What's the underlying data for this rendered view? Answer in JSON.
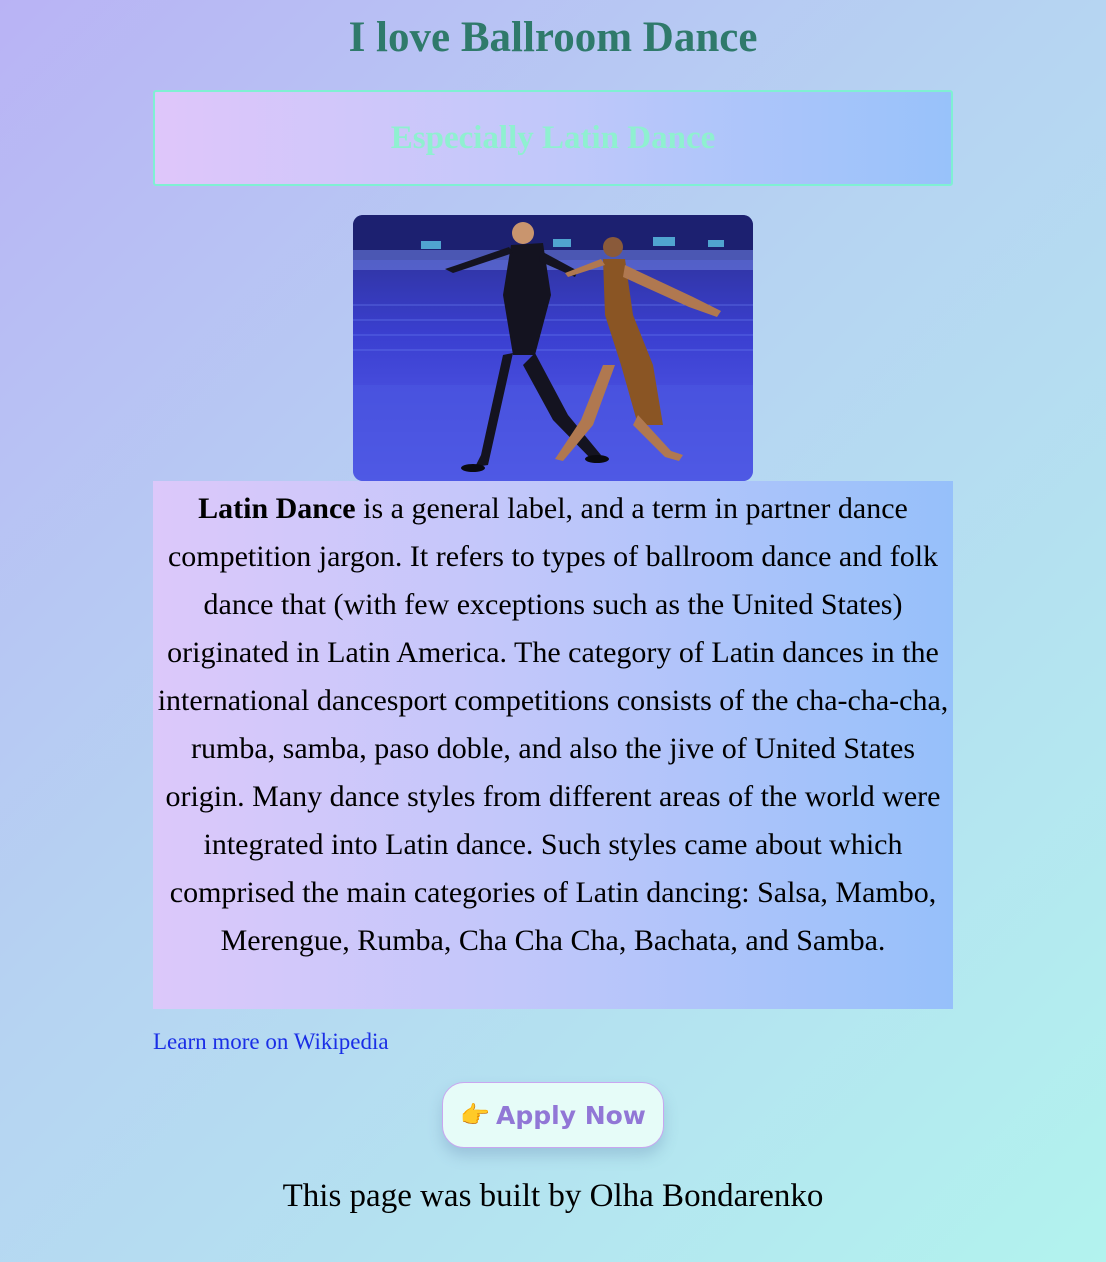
{
  "header": {
    "title": "I love Ballroom Dance"
  },
  "subtitle": "Especially Latin Dance",
  "article": {
    "bold_term": "Latin Dance",
    "body": " is a general label, and a term in partner dance competition jargon. It refers to types of ballroom dance and folk dance that (with few exceptions such as the United States) originated in Latin America. The category of Latin dances in the international dancesport competitions consists of the cha-cha-cha, rumba, samba, paso doble, and also the jive of United States origin. Many dance styles from different areas of the world were integrated into Latin dance. Such styles came about which comprised the main categories of Latin dancing: Salsa, Mambo, Merengue, Rumba, Cha Cha Cha, Bachata, and Samba."
  },
  "link": {
    "label": "Learn more on Wikipedia"
  },
  "apply_button": {
    "icon": "pointing-hand-icon",
    "emoji": "👉",
    "label": "Apply Now"
  },
  "footer": {
    "text": "This page was built by Olha Bondarenko"
  },
  "colors": {
    "title": "#2f7a6b",
    "subtitle": "#8ff0d0",
    "link": "#1a2ee6",
    "button_text": "#9177d6",
    "button_border": "#c9a6f0"
  }
}
